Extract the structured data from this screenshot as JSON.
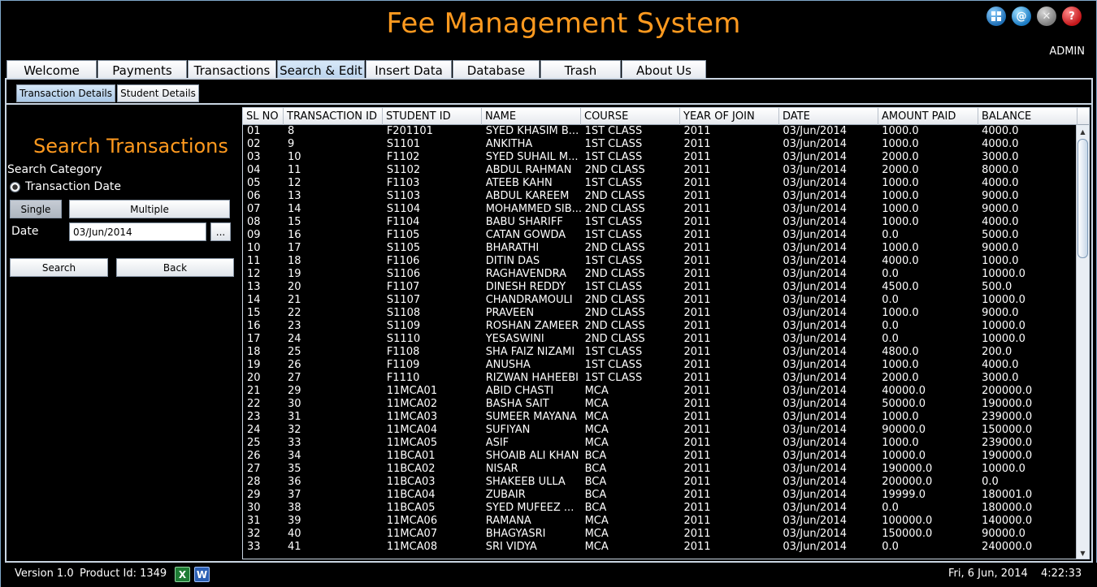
{
  "window": {
    "title": "Fee Management System",
    "user": "ADMIN",
    "icons": [
      "apps-grid-icon",
      "email-icon",
      "close-icon",
      "help-icon"
    ]
  },
  "main_tabs": [
    {
      "label": "Welcome",
      "active": false
    },
    {
      "label": "Payments",
      "active": false
    },
    {
      "label": "Transactions",
      "active": false
    },
    {
      "label": "Search & Edit",
      "active": true
    },
    {
      "label": "Insert Data",
      "active": false
    },
    {
      "label": "Database",
      "active": false
    },
    {
      "label": "Trash",
      "active": false
    },
    {
      "label": "About Us",
      "active": false
    }
  ],
  "sub_tabs": [
    {
      "label": "Transaction Details",
      "active": true
    },
    {
      "label": "Student Details",
      "active": false
    }
  ],
  "search_panel": {
    "heading": "Search Transactions",
    "category_label": "Search Category",
    "radio_label": "Transaction Date",
    "single_label": "Single",
    "multiple_label": "Multiple",
    "date_label": "Date",
    "date_value": "03/Jun/2014",
    "browse_label": "...",
    "search_label": "Search",
    "back_label": "Back"
  },
  "table": {
    "headers": [
      "SL NO",
      "TRANSACTION ID",
      "STUDENT ID",
      "NAME",
      "COURSE",
      "YEAR OF JOIN",
      "DATE",
      "AMOUNT PAID",
      "BALANCE"
    ],
    "rows": [
      [
        "01",
        "8",
        "F201101",
        "SYED KHASIM B...",
        "1ST CLASS",
        "2011",
        "03/Jun/2014",
        "1000.0",
        "4000.0"
      ],
      [
        "02",
        "9",
        "S1101",
        "ANKITHA",
        "1ST CLASS",
        "2011",
        "03/Jun/2014",
        "1000.0",
        "4000.0"
      ],
      [
        "03",
        "10",
        "F1102",
        "SYED SUHAIL M...",
        "1ST CLASS",
        "2011",
        "03/Jun/2014",
        "2000.0",
        "3000.0"
      ],
      [
        "04",
        "11",
        "S1102",
        "ABDUL RAHMAN",
        "2ND CLASS",
        "2011",
        "03/Jun/2014",
        "2000.0",
        "8000.0"
      ],
      [
        "05",
        "12",
        "F1103",
        "ATEEB KAHN",
        "1ST CLASS",
        "2011",
        "03/Jun/2014",
        "1000.0",
        "4000.0"
      ],
      [
        "06",
        "13",
        "S1103",
        "ABDUL KAREEM",
        "2ND CLASS",
        "2011",
        "03/Jun/2014",
        "1000.0",
        "9000.0"
      ],
      [
        "07",
        "14",
        "S1104",
        "MOHAMMED SIB...",
        "2ND CLASS",
        "2011",
        "03/Jun/2014",
        "1000.0",
        "9000.0"
      ],
      [
        "08",
        "15",
        "F1104",
        "BABU SHARIFF",
        "1ST CLASS",
        "2011",
        "03/Jun/2014",
        "1000.0",
        "4000.0"
      ],
      [
        "09",
        "16",
        "F1105",
        "CATAN GOWDA",
        "1ST CLASS",
        "2011",
        "03/Jun/2014",
        "0.0",
        "5000.0"
      ],
      [
        "10",
        "17",
        "S1105",
        "BHARATHI",
        "2ND CLASS",
        "2011",
        "03/Jun/2014",
        "1000.0",
        "9000.0"
      ],
      [
        "11",
        "18",
        "F1106",
        "DITIN DAS",
        "1ST CLASS",
        "2011",
        "03/Jun/2014",
        "4000.0",
        "1000.0"
      ],
      [
        "12",
        "19",
        "S1106",
        "RAGHAVENDRA",
        "2ND CLASS",
        "2011",
        "03/Jun/2014",
        "0.0",
        "10000.0"
      ],
      [
        "13",
        "20",
        "F1107",
        "DINESH REDDY",
        "1ST CLASS",
        "2011",
        "03/Jun/2014",
        "4500.0",
        "500.0"
      ],
      [
        "14",
        "21",
        "S1107",
        "CHANDRAMOULI",
        "2ND CLASS",
        "2011",
        "03/Jun/2014",
        "0.0",
        "10000.0"
      ],
      [
        "15",
        "22",
        "S1108",
        "PRAVEEN",
        "2ND CLASS",
        "2011",
        "03/Jun/2014",
        "1000.0",
        "9000.0"
      ],
      [
        "16",
        "23",
        "S1109",
        "ROSHAN ZAMEER",
        "2ND CLASS",
        "2011",
        "03/Jun/2014",
        "0.0",
        "10000.0"
      ],
      [
        "17",
        "24",
        "S1110",
        "YESASWINI",
        "2ND CLASS",
        "2011",
        "03/Jun/2014",
        "0.0",
        "10000.0"
      ],
      [
        "18",
        "25",
        "F1108",
        "SHA FAIZ NIZAMI",
        "1ST CLASS",
        "2011",
        "03/Jun/2014",
        "4800.0",
        "200.0"
      ],
      [
        "19",
        "26",
        "F1109",
        "ANUSHA",
        "1ST CLASS",
        "2011",
        "03/Jun/2014",
        "1000.0",
        "4000.0"
      ],
      [
        "20",
        "27",
        "F1110",
        "RIZWAN HAHEEBI",
        "1ST CLASS",
        "2011",
        "03/Jun/2014",
        "2000.0",
        "3000.0"
      ],
      [
        "21",
        "29",
        "11MCA01",
        "ABID CHASTI",
        "MCA",
        "2011",
        "03/Jun/2014",
        "40000.0",
        "200000.0"
      ],
      [
        "22",
        "30",
        "11MCA02",
        "BASHA SAIT",
        "MCA",
        "2011",
        "03/Jun/2014",
        "50000.0",
        "190000.0"
      ],
      [
        "23",
        "31",
        "11MCA03",
        "SUMEER MAYANA",
        "MCA",
        "2011",
        "03/Jun/2014",
        "1000.0",
        "239000.0"
      ],
      [
        "24",
        "32",
        "11MCA04",
        "SUFIYAN",
        "MCA",
        "2011",
        "03/Jun/2014",
        "90000.0",
        "150000.0"
      ],
      [
        "25",
        "33",
        "11MCA05",
        "ASIF",
        "MCA",
        "2011",
        "03/Jun/2014",
        "1000.0",
        "239000.0"
      ],
      [
        "26",
        "34",
        "11BCA01",
        "SHOAIB ALI KHAN",
        "BCA",
        "2011",
        "03/Jun/2014",
        "10000.0",
        "190000.0"
      ],
      [
        "27",
        "35",
        "11BCA02",
        "NISAR",
        "BCA",
        "2011",
        "03/Jun/2014",
        "190000.0",
        "10000.0"
      ],
      [
        "28",
        "36",
        "11BCA03",
        "SHAKEEB ULLA",
        "BCA",
        "2011",
        "03/Jun/2014",
        "200000.0",
        "0.0"
      ],
      [
        "29",
        "37",
        "11BCA04",
        "ZUBAIR",
        "BCA",
        "2011",
        "03/Jun/2014",
        "19999.0",
        "180001.0"
      ],
      [
        "30",
        "38",
        "11BCA05",
        "SYED MUFEEZ ...",
        "BCA",
        "2011",
        "03/Jun/2014",
        "0.0",
        "180000.0"
      ],
      [
        "31",
        "39",
        "11MCA06",
        "RAMANA",
        "MCA",
        "2011",
        "03/Jun/2014",
        "100000.0",
        "140000.0"
      ],
      [
        "32",
        "40",
        "11MCA07",
        "BHAGYASRI",
        "MCA",
        "2011",
        "03/Jun/2014",
        "150000.0",
        "90000.0"
      ],
      [
        "33",
        "41",
        "11MCA08",
        "SRI VIDYA",
        "MCA",
        "2011",
        "03/Jun/2014",
        "0.0",
        "240000.0"
      ]
    ]
  },
  "status_bar": {
    "version": "Version 1.0",
    "product_id": "Product Id: 1349",
    "date": "Fri, 6 Jun, 2014",
    "time": "4:22:33",
    "excel_icon_letter": "X",
    "word_icon_letter": "W"
  },
  "colors": {
    "accent": "#ff9a1f",
    "background": "#000000",
    "panel_border": "#c9d5e2"
  }
}
